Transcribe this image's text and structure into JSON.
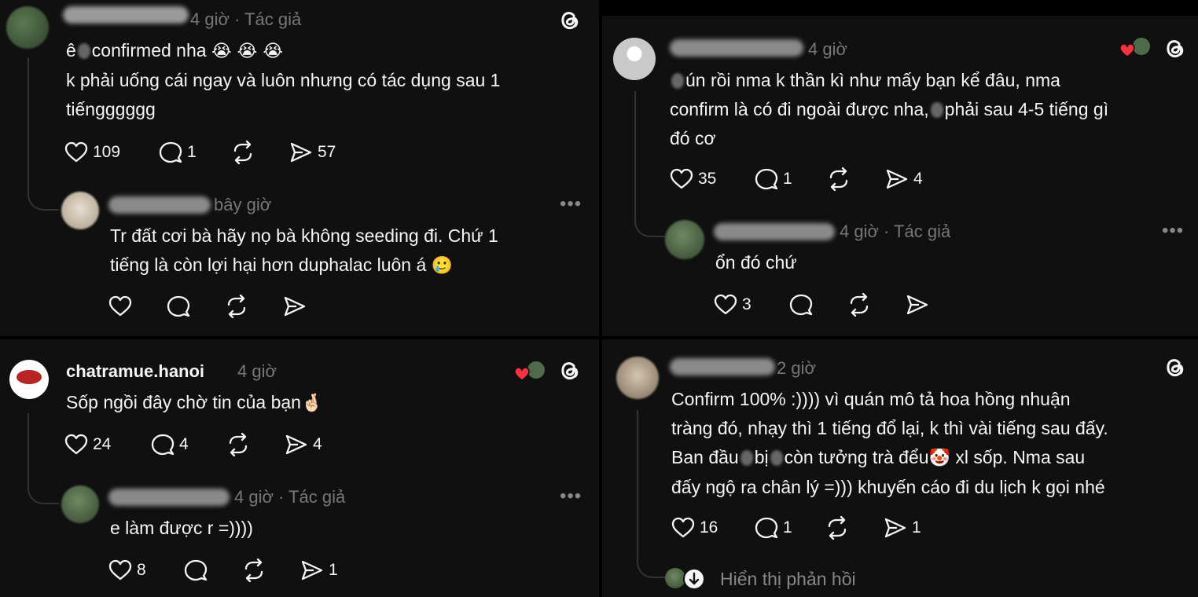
{
  "panel1": {
    "main": {
      "meta": "4 giờ · Tác giả",
      "line1_pre": "ê",
      "line1_post": "confirmed nha",
      "emoji": "😭 😭 😭",
      "line2": "k phải uống cái ngay và luôn nhưng có tác dụng sau 1",
      "line3": "tiếngggggg",
      "likes": "109",
      "replies": "1",
      "shares": "57"
    },
    "reply": {
      "meta": "bây giờ",
      "line1": "Tr đất cơi bà hãy nọ bà không seeding đi. Chứ 1",
      "line2": "tiếng là còn lợi hại hơn duphalac luôn á",
      "emoji": "🥲",
      "more": "•••"
    }
  },
  "panel2": {
    "main": {
      "username": "chatramue.hanoi",
      "meta": "4 giờ",
      "text": "Sốp ngồi đây chờ tin của bạn",
      "emoji": "🤞🏻",
      "likes": "24",
      "replies": "4",
      "shares": "4"
    },
    "reply": {
      "meta": "4 giờ · Tác giả",
      "text": "e làm được r =))))",
      "likes": "8",
      "shares": "1",
      "more": "•••"
    }
  },
  "panel3": {
    "main": {
      "meta": "4 giờ",
      "line1": "ún rồi nma k thần kì như mấy bạn kể đâu, nma",
      "line2_pre": "confirm là có đi ngoài được nha,",
      "line2_post": "phải sau 4-5 tiếng gì",
      "line3": "đó cơ",
      "likes": "35",
      "replies": "1",
      "shares": "4"
    },
    "reply": {
      "meta": "4 giờ · Tác giả",
      "text": "ổn đó chứ",
      "likes": "3",
      "more": "•••"
    }
  },
  "panel4": {
    "main": {
      "meta": "2 giờ",
      "line1": "Confirm 100% :)))) vì quán mô tả hoa hồng nhuận",
      "line2": "tràng đó, nhạy thì 1 tiếng đổ lại, k thì vài tiếng sau đấy.",
      "line3_a": "Ban đầu",
      "line3_b": "bị",
      "line3_c": "còn tưởng trà đểu",
      "line3_emoji": "🤡",
      "line3_d": " xl sốp. Nma sau",
      "line4": "đấy ngộ ra chân lý =))) khuyến cáo đi du lịch k gọi nhé",
      "likes": "16",
      "replies": "1",
      "shares": "1",
      "show_replies": "Hiển thị phản hồi"
    }
  },
  "colors": {
    "background": "#101010",
    "text": "#f3f5f7",
    "muted": "#777777",
    "liked": "#ff3040"
  },
  "icons": [
    "heart-icon",
    "comment-icon",
    "repost-icon",
    "share-icon",
    "threads-logo-icon",
    "more-icon"
  ]
}
